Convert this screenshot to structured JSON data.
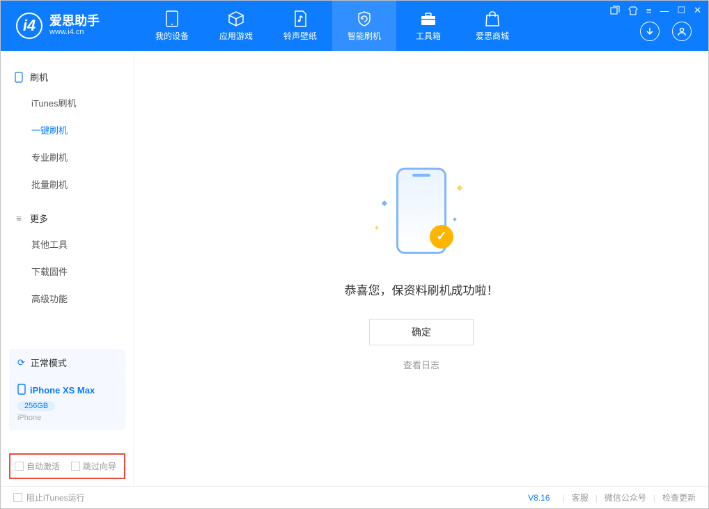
{
  "logo": {
    "title": "爱思助手",
    "url": "www.i4.cn",
    "letter": "i4"
  },
  "nav": {
    "device": "我的设备",
    "apps": "应用游戏",
    "ringtone": "铃声壁纸",
    "flash": "智能刷机",
    "toolbox": "工具箱",
    "store": "爱思商城"
  },
  "sidebar": {
    "section_flash": "刷机",
    "items_flash": {
      "itunes": "iTunes刷机",
      "oneclick": "一键刷机",
      "pro": "专业刷机",
      "batch": "批量刷机"
    },
    "section_more": "更多",
    "items_more": {
      "other": "其他工具",
      "firmware": "下载固件",
      "advanced": "高级功能"
    }
  },
  "mode": {
    "label": "正常模式"
  },
  "device": {
    "name": "iPhone XS Max",
    "storage": "256GB",
    "type": "iPhone"
  },
  "checkboxes": {
    "auto_activate": "自动激活",
    "skip_wizard": "跳过向导"
  },
  "main": {
    "success_text": "恭喜您，保资料刷机成功啦！",
    "confirm": "确定",
    "view_log": "查看日志"
  },
  "footer": {
    "block_itunes": "阻止iTunes运行",
    "version": "V8.16",
    "support": "客服",
    "wechat": "微信公众号",
    "update": "检查更新"
  }
}
